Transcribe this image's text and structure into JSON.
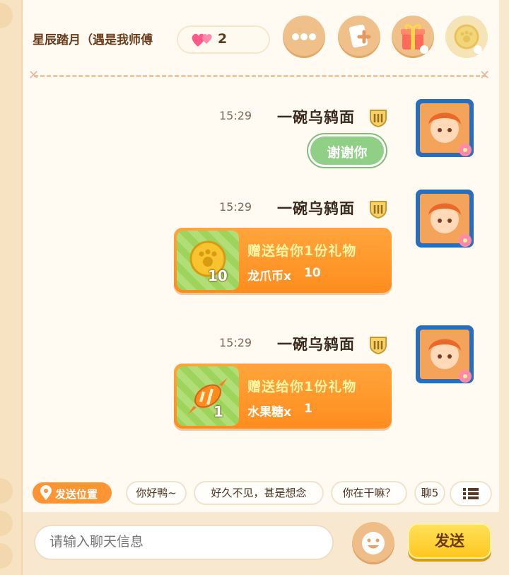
{
  "header": {
    "friend_name": "星辰踏月（遇是我师傅",
    "affinity_count": "2",
    "buttons": [
      {
        "icon": "more-dots-icon"
      },
      {
        "icon": "add-friend-card-icon"
      },
      {
        "icon": "gift-box-icon"
      },
      {
        "icon": "dragon-claw-coin-icon"
      }
    ]
  },
  "messages": [
    {
      "time": "15:29",
      "sender": "一碗乌鸫面",
      "type": "text",
      "text": "谢谢你"
    },
    {
      "time": "15:29",
      "sender": "一碗乌鸫面",
      "type": "gift",
      "gift_title": "赠送给你1份礼物",
      "item_name": "龙爪币x",
      "item_qty": "10",
      "icon_qty": "10",
      "item_icon": "dragon-claw-coin-icon"
    },
    {
      "time": "15:29",
      "sender": "一碗乌鸫面",
      "type": "gift",
      "gift_title": "赠送给你1份礼物",
      "item_name": "水果糖x",
      "item_qty": "1",
      "icon_qty": "1",
      "item_icon": "fruit-candy-icon"
    }
  ],
  "quick_replies": {
    "location_label": "发送位置",
    "chips": [
      "你好鸭~",
      "好久不见，甚是想念",
      "你在干嘛？",
      "聊5"
    ]
  },
  "input": {
    "placeholder": "请输入聊天信息",
    "send_label": "发送"
  },
  "colors": {
    "accent_orange": "#ff9434",
    "send_yellow": "#ffd23a",
    "bubble_green": "#8fcf86",
    "background": "#fffbf2"
  }
}
